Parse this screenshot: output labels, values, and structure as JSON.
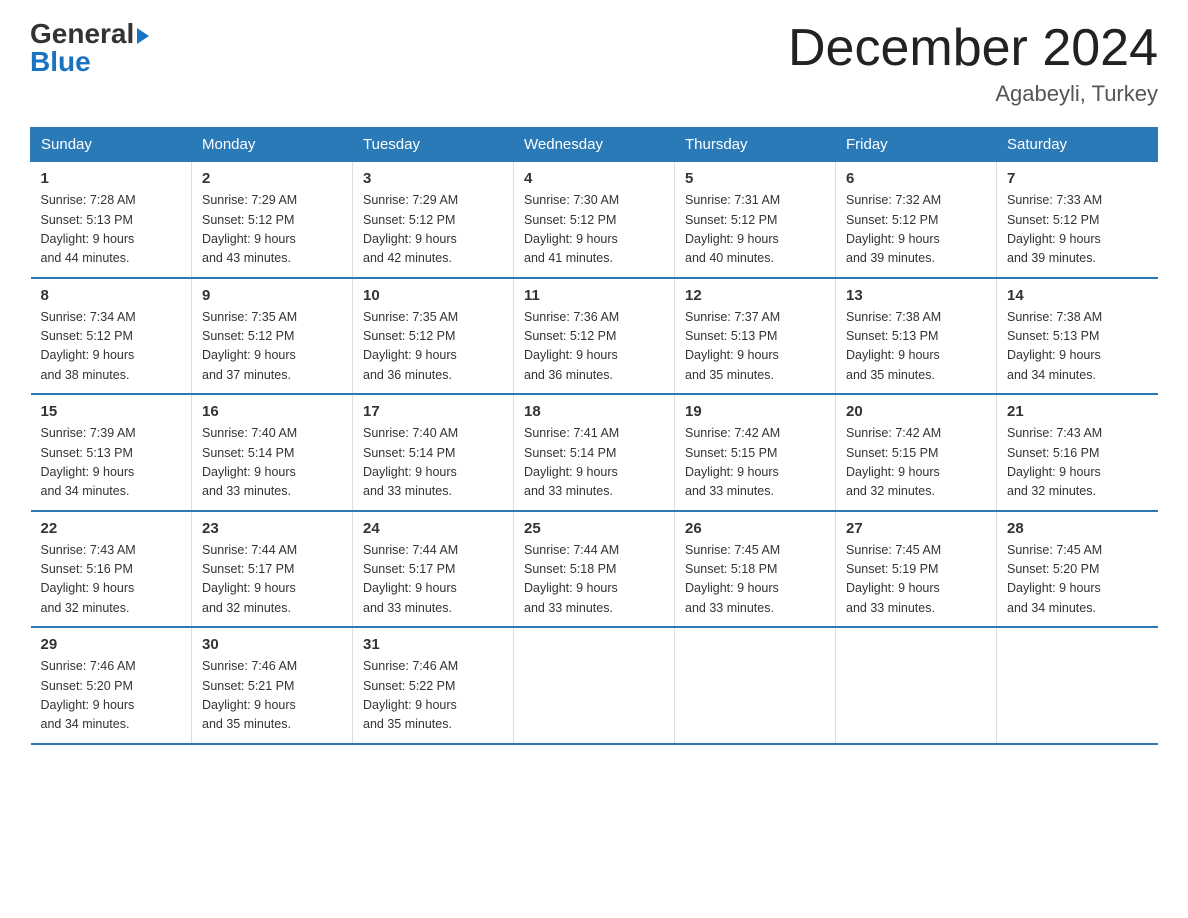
{
  "logo": {
    "general": "General",
    "triangle": "▶",
    "blue": "Blue"
  },
  "title": "December 2024",
  "location": "Agabeyli, Turkey",
  "days_header": [
    "Sunday",
    "Monday",
    "Tuesday",
    "Wednesday",
    "Thursday",
    "Friday",
    "Saturday"
  ],
  "weeks": [
    [
      {
        "num": "1",
        "sunrise": "7:28 AM",
        "sunset": "5:13 PM",
        "daylight": "9 hours and 44 minutes."
      },
      {
        "num": "2",
        "sunrise": "7:29 AM",
        "sunset": "5:12 PM",
        "daylight": "9 hours and 43 minutes."
      },
      {
        "num": "3",
        "sunrise": "7:29 AM",
        "sunset": "5:12 PM",
        "daylight": "9 hours and 42 minutes."
      },
      {
        "num": "4",
        "sunrise": "7:30 AM",
        "sunset": "5:12 PM",
        "daylight": "9 hours and 41 minutes."
      },
      {
        "num": "5",
        "sunrise": "7:31 AM",
        "sunset": "5:12 PM",
        "daylight": "9 hours and 40 minutes."
      },
      {
        "num": "6",
        "sunrise": "7:32 AM",
        "sunset": "5:12 PM",
        "daylight": "9 hours and 39 minutes."
      },
      {
        "num": "7",
        "sunrise": "7:33 AM",
        "sunset": "5:12 PM",
        "daylight": "9 hours and 39 minutes."
      }
    ],
    [
      {
        "num": "8",
        "sunrise": "7:34 AM",
        "sunset": "5:12 PM",
        "daylight": "9 hours and 38 minutes."
      },
      {
        "num": "9",
        "sunrise": "7:35 AM",
        "sunset": "5:12 PM",
        "daylight": "9 hours and 37 minutes."
      },
      {
        "num": "10",
        "sunrise": "7:35 AM",
        "sunset": "5:12 PM",
        "daylight": "9 hours and 36 minutes."
      },
      {
        "num": "11",
        "sunrise": "7:36 AM",
        "sunset": "5:12 PM",
        "daylight": "9 hours and 36 minutes."
      },
      {
        "num": "12",
        "sunrise": "7:37 AM",
        "sunset": "5:13 PM",
        "daylight": "9 hours and 35 minutes."
      },
      {
        "num": "13",
        "sunrise": "7:38 AM",
        "sunset": "5:13 PM",
        "daylight": "9 hours and 35 minutes."
      },
      {
        "num": "14",
        "sunrise": "7:38 AM",
        "sunset": "5:13 PM",
        "daylight": "9 hours and 34 minutes."
      }
    ],
    [
      {
        "num": "15",
        "sunrise": "7:39 AM",
        "sunset": "5:13 PM",
        "daylight": "9 hours and 34 minutes."
      },
      {
        "num": "16",
        "sunrise": "7:40 AM",
        "sunset": "5:14 PM",
        "daylight": "9 hours and 33 minutes."
      },
      {
        "num": "17",
        "sunrise": "7:40 AM",
        "sunset": "5:14 PM",
        "daylight": "9 hours and 33 minutes."
      },
      {
        "num": "18",
        "sunrise": "7:41 AM",
        "sunset": "5:14 PM",
        "daylight": "9 hours and 33 minutes."
      },
      {
        "num": "19",
        "sunrise": "7:42 AM",
        "sunset": "5:15 PM",
        "daylight": "9 hours and 33 minutes."
      },
      {
        "num": "20",
        "sunrise": "7:42 AM",
        "sunset": "5:15 PM",
        "daylight": "9 hours and 32 minutes."
      },
      {
        "num": "21",
        "sunrise": "7:43 AM",
        "sunset": "5:16 PM",
        "daylight": "9 hours and 32 minutes."
      }
    ],
    [
      {
        "num": "22",
        "sunrise": "7:43 AM",
        "sunset": "5:16 PM",
        "daylight": "9 hours and 32 minutes."
      },
      {
        "num": "23",
        "sunrise": "7:44 AM",
        "sunset": "5:17 PM",
        "daylight": "9 hours and 32 minutes."
      },
      {
        "num": "24",
        "sunrise": "7:44 AM",
        "sunset": "5:17 PM",
        "daylight": "9 hours and 33 minutes."
      },
      {
        "num": "25",
        "sunrise": "7:44 AM",
        "sunset": "5:18 PM",
        "daylight": "9 hours and 33 minutes."
      },
      {
        "num": "26",
        "sunrise": "7:45 AM",
        "sunset": "5:18 PM",
        "daylight": "9 hours and 33 minutes."
      },
      {
        "num": "27",
        "sunrise": "7:45 AM",
        "sunset": "5:19 PM",
        "daylight": "9 hours and 33 minutes."
      },
      {
        "num": "28",
        "sunrise": "7:45 AM",
        "sunset": "5:20 PM",
        "daylight": "9 hours and 34 minutes."
      }
    ],
    [
      {
        "num": "29",
        "sunrise": "7:46 AM",
        "sunset": "5:20 PM",
        "daylight": "9 hours and 34 minutes."
      },
      {
        "num": "30",
        "sunrise": "7:46 AM",
        "sunset": "5:21 PM",
        "daylight": "9 hours and 35 minutes."
      },
      {
        "num": "31",
        "sunrise": "7:46 AM",
        "sunset": "5:22 PM",
        "daylight": "9 hours and 35 minutes."
      },
      null,
      null,
      null,
      null
    ]
  ]
}
